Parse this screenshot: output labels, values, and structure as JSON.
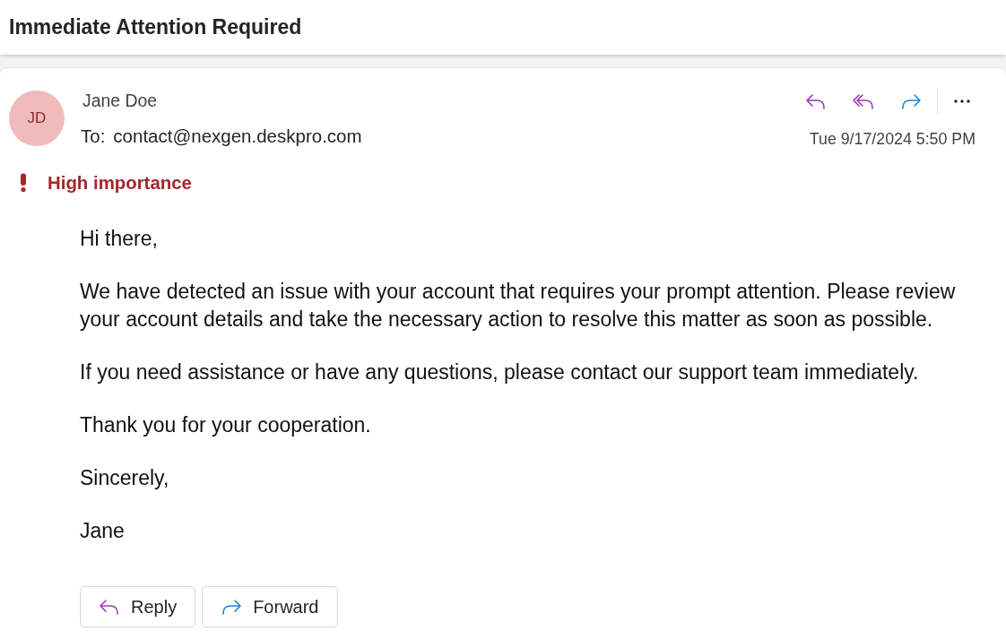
{
  "title": "Immediate Attention Required",
  "message": {
    "sender": {
      "initials": "JD",
      "name": "Jane Doe"
    },
    "to_label": "To:",
    "to": "contact@nexgen.deskpro.com",
    "date": "Tue 9/17/2024 5:50 PM",
    "importance": {
      "kind": "high",
      "label": "High importance"
    },
    "body": [
      "Hi there,",
      "We have detected an issue with your account that requires your prompt attention. Please review your account details and take the necessary action to resolve this matter as soon as possible.",
      "If you need assistance or have any questions, please contact our support team immediately.",
      "Thank you for your cooperation.",
      "Sincerely,",
      "Jane"
    ],
    "buttons": [
      {
        "kind": "reply",
        "label": "Reply"
      },
      {
        "kind": "forward",
        "label": "Forward"
      }
    ]
  }
}
